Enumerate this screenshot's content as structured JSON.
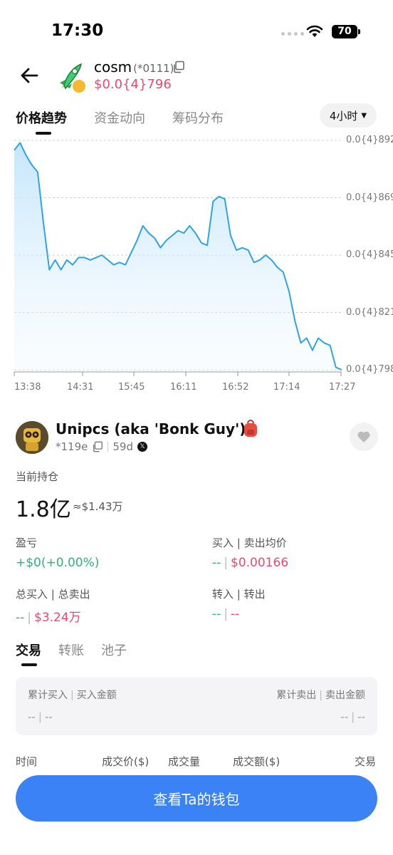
{
  "status_bar": {
    "time": "17:30",
    "battery": "70"
  },
  "token": {
    "name": "cosm",
    "address_short": "(*0111)",
    "price": "$0.0{4}796",
    "chain_badge_color": "#f3ba2f"
  },
  "chart_tabs": [
    "价格趋势",
    "资金动向",
    "筹码分布"
  ],
  "timeframe": "4小时",
  "chart_data": {
    "type": "area",
    "ylabels": [
      "0.0{4}892",
      "0.0{4}869",
      "0.0{4}845",
      "0.0{4}821",
      "0.0{4}798"
    ],
    "xlabels": [
      "13:38",
      "14:31",
      "15:45",
      "16:11",
      "16:52",
      "17:14",
      "17:27"
    ],
    "ylim": [
      7.98e-05,
      8.92e-05
    ],
    "values": [
      8.88e-05,
      8.91e-05,
      8.86e-05,
      8.82e-05,
      8.79e-05,
      8.58e-05,
      8.39e-05,
      8.43e-05,
      8.39e-05,
      8.43e-05,
      8.41e-05,
      8.44e-05,
      8.44e-05,
      8.43e-05,
      8.44e-05,
      8.45e-05,
      8.43e-05,
      8.41e-05,
      8.42e-05,
      8.41e-05,
      8.46e-05,
      8.51e-05,
      8.57e-05,
      8.54e-05,
      8.52e-05,
      8.48e-05,
      8.51e-05,
      8.53e-05,
      8.55e-05,
      8.54e-05,
      8.57e-05,
      8.54e-05,
      8.5e-05,
      8.49e-05,
      8.67e-05,
      8.69e-05,
      8.68e-05,
      8.53e-05,
      8.47e-05,
      8.48e-05,
      8.47e-05,
      8.42e-05,
      8.43e-05,
      8.45e-05,
      8.43e-05,
      8.4e-05,
      8.38e-05,
      8.3e-05,
      8.18e-05,
      8.09e-05,
      8.11e-05,
      8.06e-05,
      8.11e-05,
      8.09e-05,
      8.08e-05,
      7.99e-05,
      7.98e-05
    ],
    "line_color": "#2ea3e8",
    "grid": true
  },
  "trader": {
    "name": "Unipcs (aka 'Bonk Guy')",
    "address": "*119e",
    "age": "59d"
  },
  "holding": {
    "label": "当前持仓",
    "amount": "1.8亿",
    "usd": "≈$1.43万"
  },
  "stats": {
    "pnl_label": "盈亏",
    "pnl_value": "+$0(+0.00%)",
    "avg_label": "买入 | 卖出均价",
    "avg_buy": "--",
    "avg_sell": "$0.00166",
    "total_label": "总买入 | 总卖出",
    "total_buy": "--",
    "total_sell": "$3.24万",
    "transfer_label": "转入 | 转出",
    "transfer_in": "--",
    "transfer_out": "--"
  },
  "trade_tabs": [
    "交易",
    "转账",
    "池子"
  ],
  "summary": {
    "left_label_a": "累计买入",
    "left_label_b": "买入金额",
    "right_label_a": "累计卖出",
    "right_label_b": "卖出金额",
    "left_value_a": "--",
    "left_value_b": "--",
    "right_value_a": "--",
    "right_value_b": "--"
  },
  "table_headers": [
    "时间",
    "成交价($)",
    "成交量",
    "成交额($)",
    "交易"
  ],
  "wallet_button": "查看Ta的钱包",
  "colors": {
    "accent": "#3b82f6",
    "up": "#2bb673",
    "down": "#f0476b"
  }
}
